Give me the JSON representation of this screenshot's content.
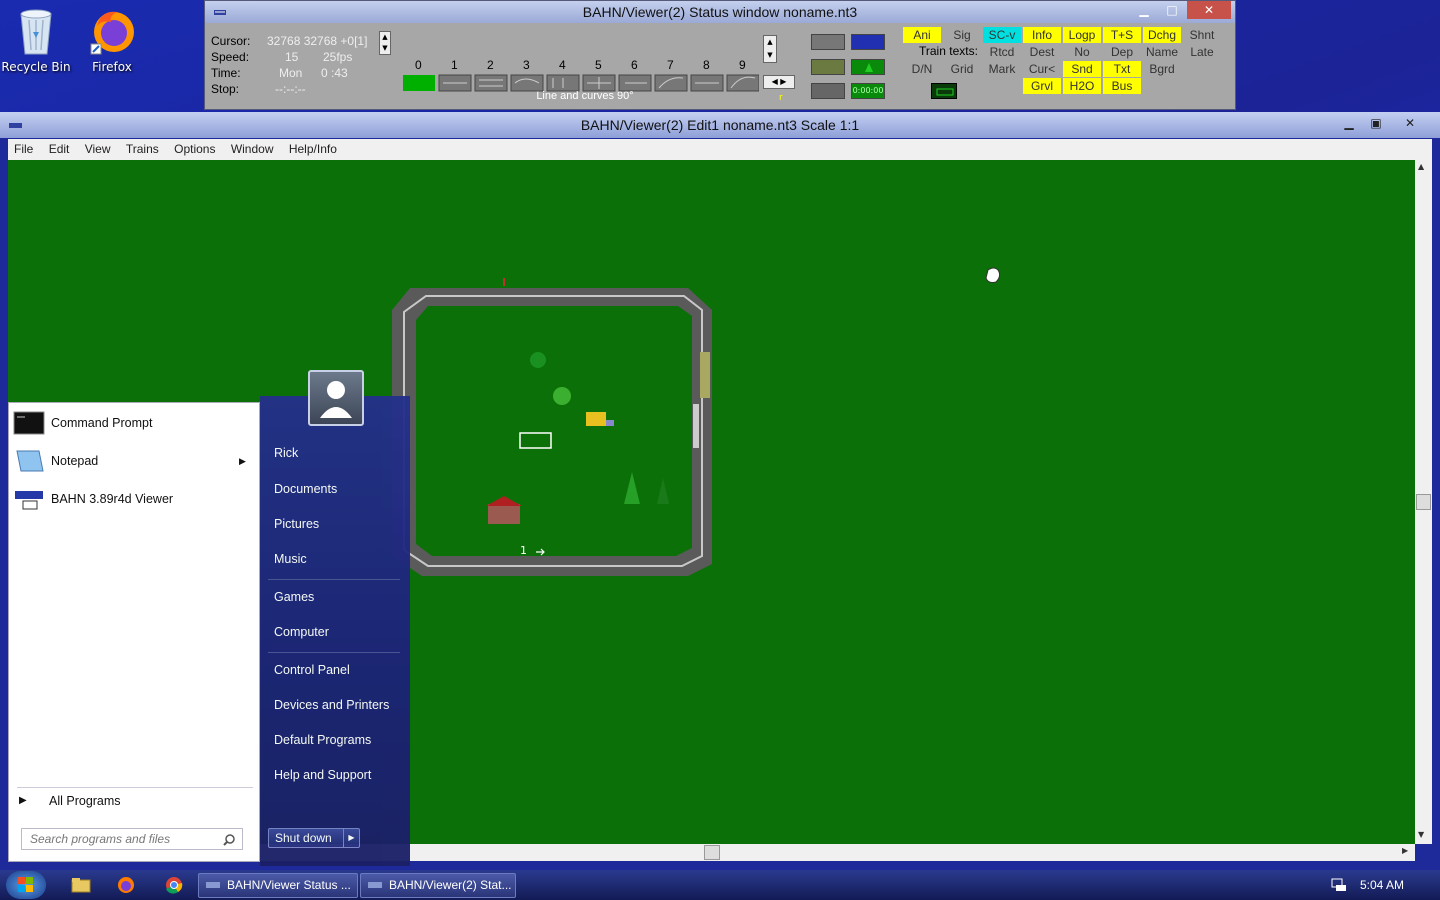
{
  "desktop": {
    "icons": [
      {
        "label": "Recycle Bin",
        "icon": "recycle-bin-icon"
      },
      {
        "label": "Firefox",
        "icon": "firefox-icon"
      }
    ]
  },
  "status_window": {
    "title": "BAHN/Viewer(2) Status window noname.nt3",
    "cursor_label": "Cursor:",
    "cursor_value": "32768 32768 +0[1]",
    "speed_label": "Speed:",
    "speed_value": "15",
    "fps_value": "25fps",
    "time_label": "Time:",
    "time_day": "Mon",
    "time_value": "0 :43",
    "stop_label": "Stop:",
    "stop_value": "--:--:--",
    "track_numbers": [
      "0",
      "1",
      "2",
      "3",
      "4",
      "5",
      "6",
      "7",
      "8",
      "9"
    ],
    "track_caption": "Line and curves 90°",
    "marker_r": "r",
    "clock_display": "0:00:00",
    "train_texts_label": "Train texts:",
    "buttons_row1": [
      "Ani",
      "Sig",
      "SC-v",
      "Info",
      "Logp",
      "T+S",
      "Dchg",
      "Shnt"
    ],
    "buttons_row2": [
      "Rtcd",
      "Dest",
      "No",
      "Dep",
      "Name",
      "Late"
    ],
    "buttons_row3": [
      "D/N",
      "Grid",
      "Mark",
      "Cur<",
      "Snd",
      "Txt",
      "Bgrd"
    ],
    "buttons_row4": [
      "Grvl",
      "H2O",
      "Bus"
    ],
    "colors": {
      "yellow": "#ffff00",
      "cyan": "#00e0e0"
    }
  },
  "editor_window": {
    "title": "BAHN/Viewer(2) Edit1 noname.nt3 Scale 1:1",
    "menu": [
      "File",
      "Edit",
      "View",
      "Trains",
      "Options",
      "Window",
      "Help/Info"
    ],
    "track_label": "1",
    "canvas_color": "#0b7008"
  },
  "start_menu": {
    "user_name": "Rick",
    "pinned": [
      {
        "label": "Command Prompt",
        "icon": "command-prompt-icon"
      },
      {
        "label": "Notepad",
        "icon": "notepad-icon"
      },
      {
        "label": "BAHN 3.89r4d Viewer",
        "icon": "bahn-viewer-icon"
      }
    ],
    "all_programs": "All Programs",
    "search_placeholder": "Search programs and files",
    "right_items": [
      "Documents",
      "Pictures",
      "Music",
      "Games",
      "Computer",
      "Control Panel",
      "Devices and Printers",
      "Default Programs",
      "Help and Support"
    ],
    "shutdown": "Shut down"
  },
  "taskbar": {
    "buttons": [
      "BAHN/Viewer Status ...",
      "BAHN/Viewer(2) Stat..."
    ],
    "clock": "5:04 AM"
  }
}
